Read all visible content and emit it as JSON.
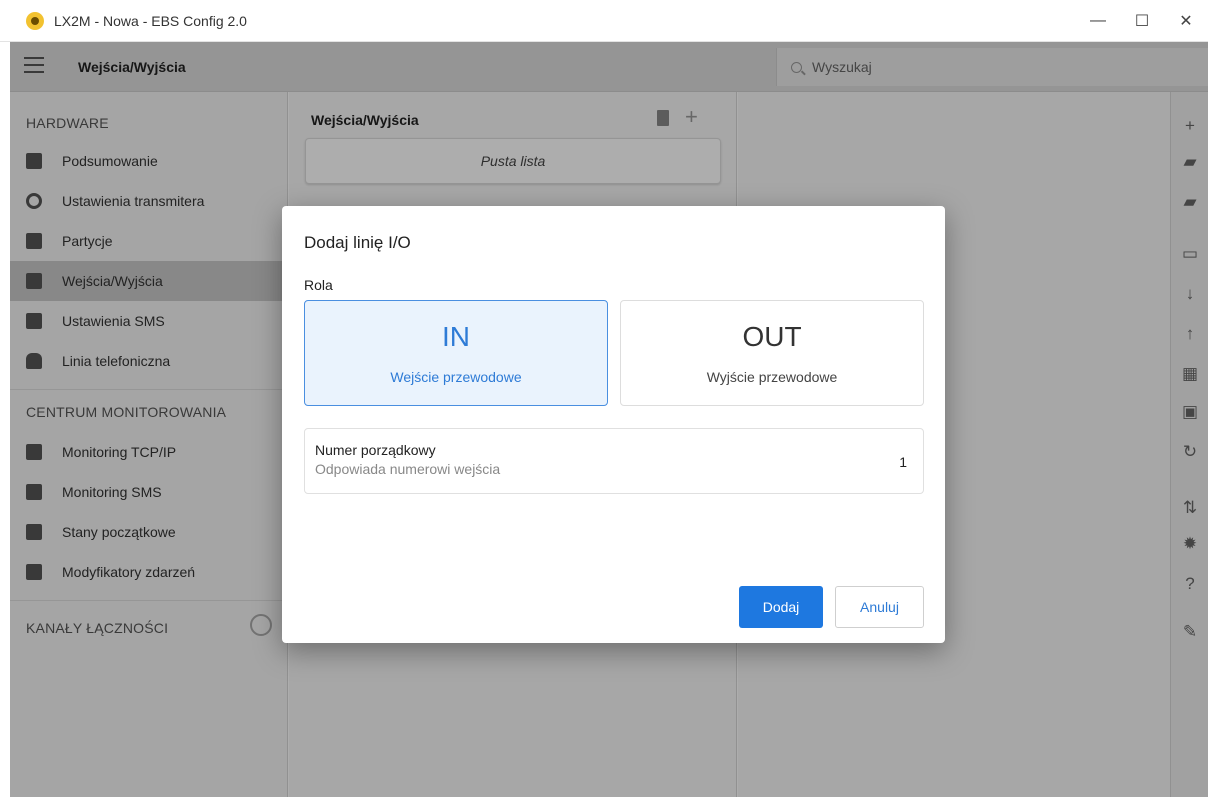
{
  "window": {
    "title": "LX2M - Nowa - EBS Config 2.0",
    "controls": {
      "minimize": "—",
      "maximize": "☐",
      "close": "✕"
    }
  },
  "appbar": {
    "title": "Wejścia/Wyjścia",
    "search_placeholder": "Wyszukaj"
  },
  "sidebar": {
    "sections": [
      {
        "header": "HARDWARE",
        "items": [
          {
            "label": "Podsumowanie",
            "icon": "clipboard-icon"
          },
          {
            "label": "Ustawienia transmitera",
            "icon": "gear-icon"
          },
          {
            "label": "Partycje",
            "icon": "houses-icon"
          },
          {
            "label": "Wejścia/Wyjścia",
            "icon": "router-icon",
            "active": true
          },
          {
            "label": "Ustawienia SMS",
            "icon": "sms-icon"
          },
          {
            "label": "Linia telefoniczna",
            "icon": "phone-icon"
          }
        ]
      },
      {
        "header": "CENTRUM MONITOROWANIA",
        "items": [
          {
            "label": "Monitoring TCP/IP",
            "icon": "document-icon"
          },
          {
            "label": "Monitoring SMS",
            "icon": "document-icon"
          },
          {
            "label": "Stany początkowe",
            "icon": "edit-icon"
          },
          {
            "label": "Modyfikatory zdarzeń",
            "icon": "edit-icon"
          }
        ]
      },
      {
        "header": "KANAŁY ŁĄCZNOŚCI",
        "items": []
      }
    ]
  },
  "middle": {
    "title": "Wejścia/Wyjścia",
    "empty_text": "Pusta lista"
  },
  "toolbar": {
    "items": [
      "plus-icon",
      "folder-add-icon",
      "folder-upload-icon",
      "monitor-icon",
      "download-icon",
      "upload-icon",
      "calendar-icon",
      "chip-icon",
      "refresh-icon",
      "sort-icon",
      "gear-icon",
      "help-icon",
      "pencil-icon"
    ]
  },
  "dialog": {
    "title": "Dodaj linię I/O",
    "role_label": "Rola",
    "roles": [
      {
        "code": "IN",
        "description": "Wejście przewodowe",
        "selected": true
      },
      {
        "code": "OUT",
        "description": "Wyjście przewodowe",
        "selected": false
      }
    ],
    "field": {
      "label": "Numer porządkowy",
      "hint": "Odpowiada numerowi wejścia",
      "value": "1"
    },
    "buttons": {
      "primary": "Dodaj",
      "secondary": "Anuluj"
    }
  },
  "colors": {
    "accent": "#1e78e0",
    "selected_bg": "#eaf3fd",
    "selected_border": "#4a8fe0"
  }
}
